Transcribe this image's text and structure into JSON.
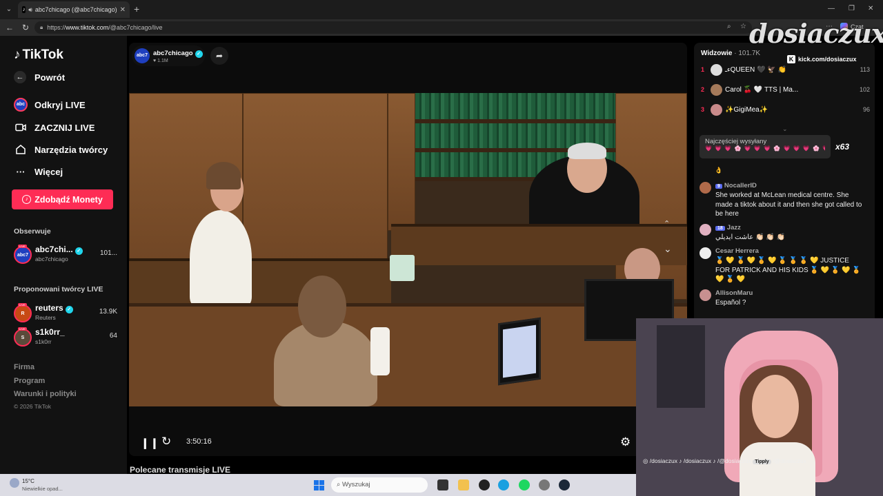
{
  "browser": {
    "tab_title": "abc7chicago (@abc7chicago)",
    "url_prefix": "https://",
    "url_domain": "www.tiktok.com",
    "url_path": "/@abc7chicago/live",
    "chat_label": "Czat"
  },
  "sidebar": {
    "logo": "TikTok",
    "back": "Powrót",
    "nav": [
      {
        "label": "Odkryj LIVE",
        "icon": "live-icon"
      },
      {
        "label": "ZACZNIJ LIVE",
        "icon": "camera-icon"
      },
      {
        "label": "Narzędzia twórcy",
        "icon": "home-icon"
      },
      {
        "label": "Więcej",
        "icon": "more-icon"
      }
    ],
    "coins_button": "Zdobądź Monety",
    "following_header": "Obserwuje",
    "following": [
      {
        "name": "abc7chi...",
        "sub": "abc7chicago",
        "right": "101...",
        "verified": true,
        "avatar": "abc7"
      }
    ],
    "suggested_header": "Proponowani twórcy LIVE",
    "suggested": [
      {
        "name": "reuters",
        "sub": "Reuters",
        "right": "13.9K",
        "verified": true,
        "avatar": "R"
      },
      {
        "name": "s1k0rr_",
        "sub": "s1k0rr",
        "right": "64",
        "verified": false,
        "avatar": "S"
      }
    ],
    "footer": [
      "Firma",
      "Program",
      "Warunki i polityki"
    ],
    "copyright": "© 2026 TikTok",
    "live_tag": "LIVE"
  },
  "player": {
    "host_name": "abc7chicago",
    "host_avatar": "abc7",
    "host_likes": "1.1M",
    "elapsed": "3:50:16"
  },
  "recommended_title": "Polecane transmisje LIVE",
  "chat": {
    "viewers_label": "Widzowie",
    "viewers_count": "· 101.7K",
    "ranking": [
      {
        "rank": "1",
        "name": "ءـQUEEN 🖤 🦅 👏",
        "score": "113"
      },
      {
        "rank": "2",
        "name": "Carol 🍒 🤍 TTS | Ma...",
        "score": "102"
      },
      {
        "rank": "3",
        "name": "✨GigiMea✨",
        "score": "96"
      }
    ],
    "gift_label": "Najczęściej wysyłany",
    "gift_hearts": "💗 💗 💗 🌸 💗 💗 💗 🌸 💗 💗 💗 🌸 💗 🌸 💗 💗 💗 🌸 💗 🌸 ...",
    "gift_count": "x63",
    "partial_emoji": "👌",
    "messages": [
      {
        "level": "9",
        "name": "NocallerID",
        "text": "She worked at McLean medical centre. She made a tiktok about it and then she got called to be here"
      },
      {
        "level": "18",
        "name": "Jazz",
        "text": "عاشت ايديلي 👏🏻 👏🏻 👏🏻"
      },
      {
        "level": "",
        "name": "Cesar Herrera",
        "text": "🏅 💛 🏅 💛 🏅 💛 🏅 🏅 🏅 💛 JUSTICE FOR PATRICK AND HIS KIDS 🏅 💛 🏅 💛 🏅 💛 🏅 💛"
      },
      {
        "level": "",
        "name": "AllisonMaru",
        "text": "Español ?"
      }
    ]
  },
  "overlay": {
    "watermark": "dosiaczux",
    "kick_text": "kick.com/dosiaczux",
    "kick_badge": "K",
    "socials": "◎ /dosiaczux   ♪ /dosiaczux   ♪ /@dosiaczux",
    "tipply_label": "Tipply",
    "tipply_handle": "/@dosiaczux"
  },
  "taskbar": {
    "temp": "15°C",
    "weather": "Niewielkie opad...",
    "search": "Wyszukaj"
  },
  "colors": {
    "accent": "#fe2c55",
    "verified": "#20d5ec",
    "sidebar_bg": "#121212"
  }
}
